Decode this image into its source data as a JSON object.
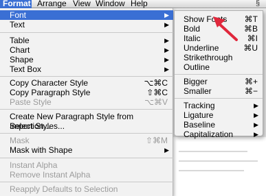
{
  "menubar": {
    "items": [
      "Format",
      "Arrange",
      "View",
      "Window",
      "Help"
    ],
    "app_icon": "script-icon"
  },
  "format_menu": {
    "items": [
      {
        "label": "Font",
        "submenu": true,
        "selected": true
      },
      {
        "label": "Text",
        "submenu": true
      },
      {
        "label": "Table",
        "submenu": true
      },
      {
        "label": "Chart",
        "submenu": true
      },
      {
        "label": "Shape",
        "submenu": true
      },
      {
        "label": "Text Box",
        "submenu": true
      },
      {
        "label": "Copy Character Style",
        "shortcut": "⌥⌘C"
      },
      {
        "label": "Copy Paragraph Style",
        "shortcut": "⇧⌘C"
      },
      {
        "label": "Paste Style",
        "shortcut": "⌥⌘V",
        "disabled": true
      },
      {
        "label": "Create New Paragraph Style from Selection..."
      },
      {
        "label": "Import Styles..."
      },
      {
        "label": "Mask",
        "shortcut": "⇧⌘M",
        "disabled": true
      },
      {
        "label": "Mask with Shape",
        "submenu": true
      },
      {
        "label": "Instant Alpha",
        "disabled": true
      },
      {
        "label": "Remove Instant Alpha",
        "disabled": true
      },
      {
        "label": "Reapply Defaults to Selection",
        "disabled": true
      }
    ]
  },
  "font_submenu": {
    "items": [
      {
        "label": "Show Fonts",
        "shortcut": "⌘T"
      },
      {
        "label": "Bold",
        "shortcut": "⌘B"
      },
      {
        "label": "Italic",
        "shortcut": "⌘I"
      },
      {
        "label": "Underline",
        "shortcut": "⌘U"
      },
      {
        "label": "Strikethrough"
      },
      {
        "label": "Outline"
      },
      {
        "label": "Bigger",
        "shortcut": "⌘+"
      },
      {
        "label": "Smaller",
        "shortcut": "⌘−"
      },
      {
        "label": "Tracking",
        "submenu": true
      },
      {
        "label": "Ligature",
        "submenu": true
      },
      {
        "label": "Baseline",
        "submenu": true
      },
      {
        "label": "Capitalization",
        "submenu": true
      }
    ]
  },
  "colors": {
    "selection": "#3a6fd4",
    "annotation_arrow": "#e0283c"
  }
}
